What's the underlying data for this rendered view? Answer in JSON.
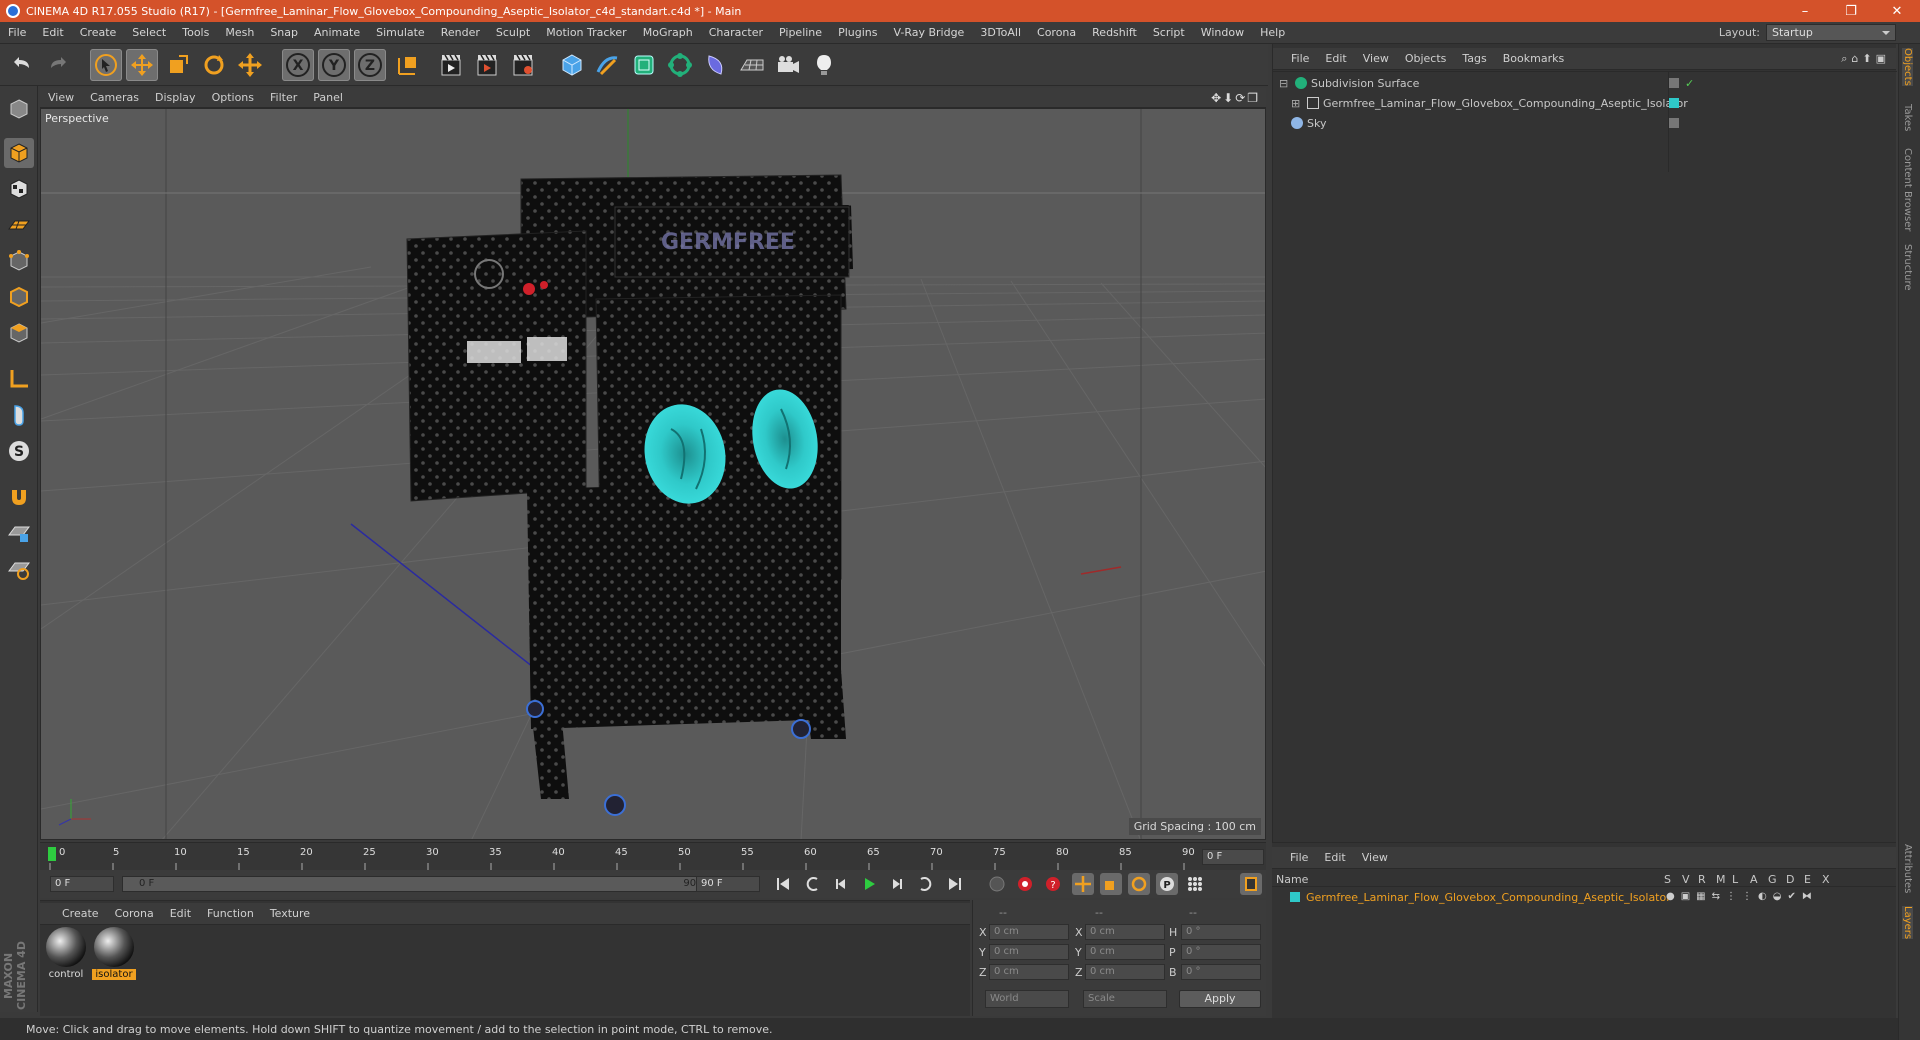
{
  "window": {
    "title": "CINEMA 4D R17.055 Studio (R17) - [Germfree_Laminar_Flow_Glovebox_Compounding_Aseptic_Isolator_c4d_standart.c4d *] - Main",
    "controls": [
      "–",
      "❐",
      "✕"
    ]
  },
  "menubar": {
    "items": [
      "File",
      "Edit",
      "Create",
      "Select",
      "Tools",
      "Mesh",
      "Snap",
      "Animate",
      "Simulate",
      "Render",
      "Sculpt",
      "Motion Tracker",
      "MoGraph",
      "Character",
      "Pipeline",
      "Plugins",
      "V-Ray Bridge",
      "3DToAll",
      "Corona",
      "Redshift",
      "Script",
      "Window",
      "Help"
    ],
    "layout_label": "Layout:",
    "layout_value": "Startup"
  },
  "toolbar": {
    "icons": [
      "undo-icon",
      "redo-icon",
      "select-icon",
      "move-icon",
      "scale-icon",
      "rotate-icon",
      "live-select-icon",
      "x-axis-icon",
      "y-axis-icon",
      "z-axis-icon",
      "world-coords-icon",
      "render-view-icon",
      "render-picture-icon",
      "render-settings-icon",
      "cube-icon",
      "pen-icon",
      "subdivision-icon",
      "array-icon",
      "deformer-icon",
      "floor-icon",
      "camera-icon",
      "light-icon"
    ],
    "axis_labels": [
      "X",
      "Y",
      "Z"
    ]
  },
  "left_tools": {
    "icons": [
      "make-editable-icon",
      "model-mode-icon",
      "texture-mode-icon",
      "workplane-icon",
      "points-mode-icon",
      "edges-mode-icon",
      "polygons-mode-icon",
      "axis-mode-icon",
      "tweak-icon",
      "snap-s-icon",
      "magnet-icon",
      "grid-lock-icon",
      "grid-snap-icon"
    ]
  },
  "viewport": {
    "menu": [
      "View",
      "Cameras",
      "Display",
      "Options",
      "Filter",
      "Panel"
    ],
    "label": "Perspective",
    "grid_spacing": "Grid Spacing : 100 cm",
    "logo_text": "GERMFREE",
    "colors": {
      "accent_glove": "#2fc9c9",
      "background": "#5a5a5a",
      "model": "#111111"
    }
  },
  "object_manager": {
    "menu": [
      "File",
      "Edit",
      "View",
      "Objects",
      "Tags",
      "Bookmarks"
    ],
    "objects": [
      {
        "name": "Subdivision Surface",
        "color": "#c9c9c9"
      },
      {
        "name": "Germfree_Laminar_Flow_Glovebox_Compounding_Aseptic_Isolator",
        "color": "#c9c9c9"
      },
      {
        "name": "Sky",
        "color": "#c9c9c9"
      }
    ]
  },
  "side_tabs": [
    "Objects",
    "Takes",
    "Content Browser",
    "Structure"
  ],
  "side_tabs_lower": [
    "Attributes",
    "Layers"
  ],
  "timeline": {
    "ticks": [
      "0",
      "5",
      "10",
      "15",
      "20",
      "25",
      "30",
      "35",
      "40",
      "45",
      "50",
      "55",
      "60",
      "65",
      "70",
      "75",
      "80",
      "85",
      "90"
    ],
    "current_frame": "0 F"
  },
  "transport": {
    "start_field": "0 F",
    "range_start": "0 F",
    "range_end": "90 F",
    "end_field": "90 F"
  },
  "material_manager": {
    "menu": [
      "Create",
      "Corona",
      "Edit",
      "Function",
      "Texture"
    ],
    "materials": [
      {
        "name": "control",
        "selected": false
      },
      {
        "name": "isolator",
        "selected": true
      }
    ]
  },
  "coordinates": {
    "headers": [
      "--",
      "--",
      "--"
    ],
    "rows": [
      {
        "a": "X",
        "av": "0 cm",
        "b": "X",
        "bv": "0 cm",
        "c": "H",
        "cv": "0 °"
      },
      {
        "a": "Y",
        "av": "0 cm",
        "b": "Y",
        "bv": "0 cm",
        "c": "P",
        "cv": "0 °"
      },
      {
        "a": "Z",
        "av": "0 cm",
        "b": "Z",
        "bv": "0 cm",
        "c": "B",
        "cv": "0 °"
      }
    ],
    "world": "World",
    "scale": "Scale",
    "apply": "Apply"
  },
  "layer_manager": {
    "menu": [
      "File",
      "Edit",
      "View"
    ],
    "header_name": "Name",
    "columns": [
      "S",
      "V",
      "R",
      "M",
      "L",
      "A",
      "G",
      "D",
      "E",
      "X"
    ],
    "item": "Germfree_Laminar_Flow_Glovebox_Compounding_Aseptic_Isolator"
  },
  "status": "Move: Click and drag to move elements. Hold down SHIFT to quantize movement / add to the selection in point mode, CTRL to remove.",
  "maxon_logo": "MAXON CINEMA 4D"
}
